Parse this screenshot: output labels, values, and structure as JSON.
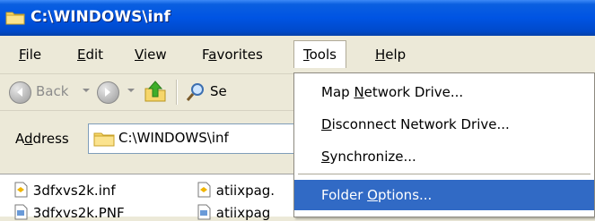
{
  "window": {
    "title": "C:\\WINDOWS\\inf"
  },
  "menu": {
    "file": {
      "ul": "F",
      "rest": "ile"
    },
    "edit": {
      "ul": "E",
      "rest": "dit"
    },
    "view": {
      "ul": "V",
      "rest": "iew"
    },
    "favorites": {
      "pre": "F",
      "ul": "a",
      "rest": "vorites"
    },
    "tools": {
      "ul": "T",
      "rest": "ools"
    },
    "help": {
      "ul": "H",
      "rest": "elp"
    }
  },
  "toolbar": {
    "back_label": "Back",
    "search_label": "Se"
  },
  "address": {
    "label_pre": "A",
    "label_ul": "d",
    "label_rest": "dress",
    "value": "C:\\WINDOWS\\inf"
  },
  "files": [
    {
      "name": "3dfxvs2k.inf"
    },
    {
      "name": "atiixpag."
    },
    {
      "name": "3dfxvs2k.PNF"
    },
    {
      "name": "atiixpag"
    }
  ],
  "tools_menu": {
    "map": {
      "pre": "Map ",
      "ul": "N",
      "rest": "etwork Drive..."
    },
    "disc": {
      "pre": "",
      "ul": "D",
      "rest": "isconnect Network Drive..."
    },
    "sync": {
      "pre": "",
      "ul": "S",
      "rest": "ynchronize..."
    },
    "folder": {
      "pre": "Folder ",
      "ul": "O",
      "rest": "ptions..."
    }
  },
  "colors": {
    "titlebar": "#0054e3",
    "highlight": "#316ac5",
    "chrome": "#ece9d8"
  }
}
